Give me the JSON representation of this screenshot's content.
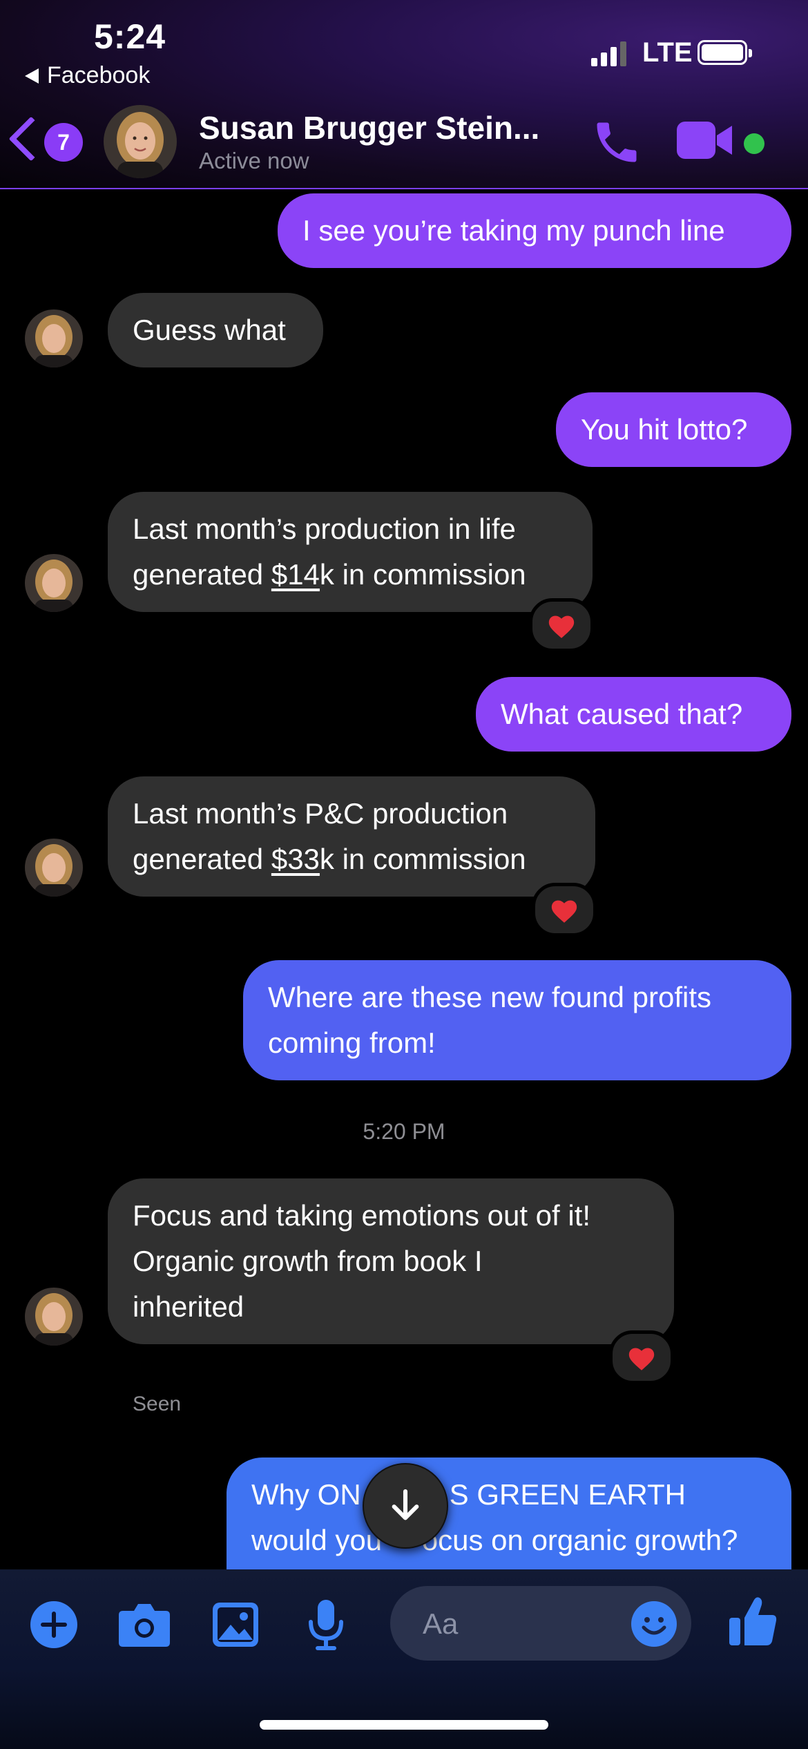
{
  "status_bar": {
    "time": "5:24",
    "back_app": "Facebook",
    "network": "LTE"
  },
  "header": {
    "unread_count": "7",
    "contact_name": "Susan Brugger Stein...",
    "contact_status": "Active now",
    "accent_color": "#8b44f7",
    "online_color": "#31c24d"
  },
  "messages": [
    {
      "id": "m1",
      "direction": "outgoing",
      "text": "I see you’re taking my punch line"
    },
    {
      "id": "m2",
      "direction": "incoming",
      "text": "Guess what"
    },
    {
      "id": "m3",
      "direction": "outgoing",
      "text": "You hit lotto?"
    },
    {
      "id": "m4",
      "direction": "incoming",
      "line1": "Last month’s production in life",
      "line2_pre": "generated ",
      "line2_link": "$14",
      "line2_post": "k in commission",
      "reaction": "heart"
    },
    {
      "id": "m5",
      "direction": "outgoing",
      "text": "What caused that?"
    },
    {
      "id": "m6",
      "direction": "incoming",
      "line1": "Last month’s P&C production",
      "line2_pre": "generated ",
      "line2_link": "$33",
      "line2_post": "k in commission",
      "reaction": "heart"
    },
    {
      "id": "m7",
      "direction": "outgoing",
      "line1": "Where are these new found profits",
      "line2": "coming from!"
    },
    {
      "id": "m8",
      "direction": "incoming",
      "line1": "Focus and taking emotions out of it!",
      "line2": "Organic growth from book I",
      "line3": "inherited",
      "reaction": "heart"
    },
    {
      "id": "m9",
      "direction": "outgoing",
      "line1_pre": "Why ON",
      "line1_post": "S GREEN EARTH",
      "line2_pre": "would you ",
      "line2_post": "ocus on organic growth?"
    }
  ],
  "timestamp": "5:20 PM",
  "seen_label": "Seen",
  "composer": {
    "placeholder": "Aa",
    "icons": [
      "plus-icon",
      "camera-icon",
      "gallery-icon",
      "microphone-icon",
      "emoji-icon",
      "thumbs-up-icon"
    ],
    "icon_color": "#3b82f6"
  }
}
